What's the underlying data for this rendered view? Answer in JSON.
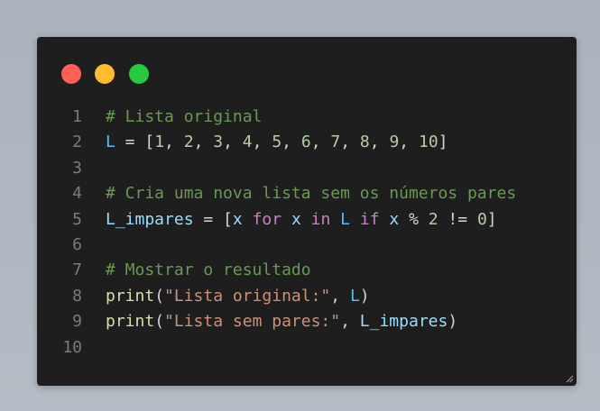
{
  "window": {
    "controls": {
      "close_color": "#ff5f57",
      "minimize_color": "#febc2e",
      "maximize_color": "#28c840"
    }
  },
  "code": {
    "lines": [
      {
        "number": "1",
        "tokens": [
          {
            "t": "# Lista original",
            "k": "comment"
          }
        ]
      },
      {
        "number": "2",
        "tokens": [
          {
            "t": "L",
            "k": "var"
          },
          {
            "t": " = [",
            "k": "op"
          },
          {
            "t": "1",
            "k": "num"
          },
          {
            "t": ", ",
            "k": "op"
          },
          {
            "t": "2",
            "k": "num"
          },
          {
            "t": ", ",
            "k": "op"
          },
          {
            "t": "3",
            "k": "num"
          },
          {
            "t": ", ",
            "k": "op"
          },
          {
            "t": "4",
            "k": "num"
          },
          {
            "t": ", ",
            "k": "op"
          },
          {
            "t": "5",
            "k": "num"
          },
          {
            "t": ", ",
            "k": "op"
          },
          {
            "t": "6",
            "k": "num"
          },
          {
            "t": ", ",
            "k": "op"
          },
          {
            "t": "7",
            "k": "num"
          },
          {
            "t": ", ",
            "k": "op"
          },
          {
            "t": "8",
            "k": "num"
          },
          {
            "t": ", ",
            "k": "op"
          },
          {
            "t": "9",
            "k": "num"
          },
          {
            "t": ", ",
            "k": "op"
          },
          {
            "t": "10",
            "k": "num"
          },
          {
            "t": "]",
            "k": "op"
          }
        ]
      },
      {
        "number": "3",
        "tokens": []
      },
      {
        "number": "4",
        "tokens": [
          {
            "t": "# Cria uma nova lista sem os números pares",
            "k": "comment"
          }
        ]
      },
      {
        "number": "5",
        "tokens": [
          {
            "t": "L_impares",
            "k": "id"
          },
          {
            "t": " = [",
            "k": "op"
          },
          {
            "t": "x",
            "k": "id"
          },
          {
            "t": " ",
            "k": "op"
          },
          {
            "t": "for",
            "k": "kw"
          },
          {
            "t": " ",
            "k": "op"
          },
          {
            "t": "x",
            "k": "id"
          },
          {
            "t": " ",
            "k": "op"
          },
          {
            "t": "in",
            "k": "kw"
          },
          {
            "t": " ",
            "k": "op"
          },
          {
            "t": "L",
            "k": "var"
          },
          {
            "t": " ",
            "k": "op"
          },
          {
            "t": "if",
            "k": "kw"
          },
          {
            "t": " ",
            "k": "op"
          },
          {
            "t": "x",
            "k": "id"
          },
          {
            "t": " % ",
            "k": "op"
          },
          {
            "t": "2",
            "k": "num"
          },
          {
            "t": " != ",
            "k": "op"
          },
          {
            "t": "0",
            "k": "num"
          },
          {
            "t": "]",
            "k": "op"
          }
        ]
      },
      {
        "number": "6",
        "tokens": []
      },
      {
        "number": "7",
        "tokens": [
          {
            "t": "# Mostrar o resultado",
            "k": "comment"
          }
        ]
      },
      {
        "number": "8",
        "tokens": [
          {
            "t": "print",
            "k": "fn"
          },
          {
            "t": "(",
            "k": "op"
          },
          {
            "t": "\"Lista original:\"",
            "k": "str"
          },
          {
            "t": ", ",
            "k": "op"
          },
          {
            "t": "L",
            "k": "var"
          },
          {
            "t": ")",
            "k": "op"
          }
        ]
      },
      {
        "number": "9",
        "tokens": [
          {
            "t": "print",
            "k": "fn"
          },
          {
            "t": "(",
            "k": "op"
          },
          {
            "t": "\"Lista sem pares:\"",
            "k": "str"
          },
          {
            "t": ", ",
            "k": "op"
          },
          {
            "t": "L_impares",
            "k": "id"
          },
          {
            "t": ")",
            "k": "op"
          }
        ]
      },
      {
        "number": "10",
        "tokens": []
      }
    ]
  }
}
